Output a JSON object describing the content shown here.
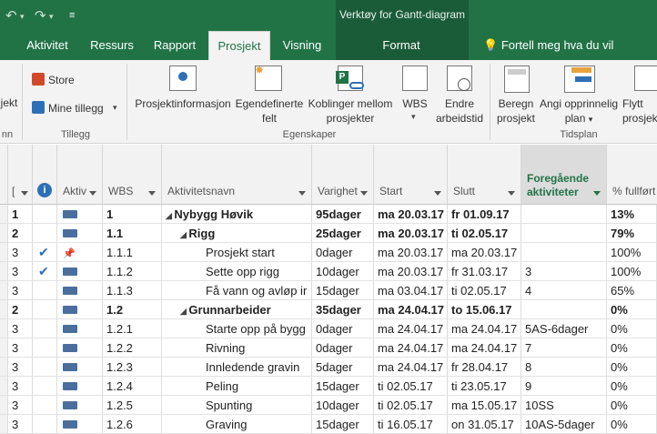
{
  "titlebar": {
    "undo_icon": "undo-icon",
    "redo_icon": "redo-icon",
    "contextual_tab": "Verktøy for Gantt-diagram"
  },
  "tabs": [
    {
      "label": "Aktivitet"
    },
    {
      "label": "Ressurs"
    },
    {
      "label": "Rapport"
    },
    {
      "label": "Prosjekt",
      "active": true
    },
    {
      "label": "Visning"
    },
    {
      "label": "Format"
    }
  ],
  "tellme": "Fortell meg hva du vil gjøre",
  "ribbon": {
    "partial_left": "jekt",
    "partial_left_group": "nn",
    "addins": {
      "store": "Store",
      "my_addins": "Mine tillegg",
      "group": "Tillegg"
    },
    "properties": {
      "project_info": "Prosjektinformasjon",
      "custom_fields": [
        "Egendefinerte",
        "felt"
      ],
      "links": [
        "Koblinger mellom",
        "prosjekter"
      ],
      "wbs": "WBS",
      "change_time": [
        "Endre",
        "arbeidstid"
      ],
      "group": "Egenskaper"
    },
    "schedule": {
      "calculate": [
        "Beregn",
        "prosjekt"
      ],
      "set_baseline": [
        "Angi opprinnelig",
        "plan"
      ],
      "move": [
        "Flytt",
        "prosjek"
      ],
      "group": "Tidsplan"
    }
  },
  "columns": {
    "indicator": "",
    "info": "",
    "mode": "Aktiv",
    "wbs": "WBS",
    "name": "Aktivitetsnavn",
    "duration": "Varighet",
    "start": "Start",
    "finish": "Slutt",
    "pred": [
      "Foregående",
      "aktiviteter"
    ],
    "pct": "% fullført"
  },
  "rows": [
    {
      "lvl": "1",
      "wbs": "1",
      "name": "Nybygg Høvik",
      "dur": "95dager",
      "start": "ma 20.03.17",
      "finish": "fr 01.09.17",
      "pred": "",
      "pct": "13%",
      "bold": true,
      "indent": 0,
      "collapse": true,
      "check": false,
      "pin": false
    },
    {
      "lvl": "2",
      "wbs": "1.1",
      "name": "Rigg",
      "dur": "25dager",
      "start": "ma 20.03.17",
      "finish": "ti 02.05.17",
      "pred": "",
      "pct": "79%",
      "bold": true,
      "indent": 1,
      "collapse": true,
      "check": false,
      "pin": false
    },
    {
      "lvl": "3",
      "wbs": "1.1.1",
      "name": "Prosjekt start",
      "dur": "0dager",
      "start": "ma 20.03.17",
      "finish": "ma 20.03.17",
      "pred": "",
      "pct": "100%",
      "bold": false,
      "indent": 2,
      "collapse": false,
      "check": true,
      "pin": true
    },
    {
      "lvl": "3",
      "wbs": "1.1.2",
      "name": "Sette opp rigg",
      "dur": "10dager",
      "start": "ma 20.03.17",
      "finish": "fr 31.03.17",
      "pred": "3",
      "pct": "100%",
      "bold": false,
      "indent": 2,
      "collapse": false,
      "check": true,
      "pin": false
    },
    {
      "lvl": "3",
      "wbs": "1.1.3",
      "name": "Få vann og avløp ir",
      "dur": "15dager",
      "start": "ma 03.04.17",
      "finish": "ti 02.05.17",
      "pred": "4",
      "pct": "65%",
      "bold": false,
      "indent": 2,
      "collapse": false,
      "check": false,
      "pin": false
    },
    {
      "lvl": "2",
      "wbs": "1.2",
      "name": "Grunnarbeider",
      "dur": "35dager",
      "start": "ma 24.04.17",
      "finish": "to 15.06.17",
      "pred": "",
      "pct": "0%",
      "bold": true,
      "indent": 1,
      "collapse": true,
      "check": false,
      "pin": false
    },
    {
      "lvl": "3",
      "wbs": "1.2.1",
      "name": "Starte opp på bygg",
      "dur": "0dager",
      "start": "ma 24.04.17",
      "finish": "ma 24.04.17",
      "pred": "5AS-6dager",
      "pct": "0%",
      "bold": false,
      "indent": 2,
      "collapse": false,
      "check": false,
      "pin": false
    },
    {
      "lvl": "3",
      "wbs": "1.2.2",
      "name": "Rivning",
      "dur": "0dager",
      "start": "ma 24.04.17",
      "finish": "ma 24.04.17",
      "pred": "7",
      "pct": "0%",
      "bold": false,
      "indent": 2,
      "collapse": false,
      "check": false,
      "pin": false
    },
    {
      "lvl": "3",
      "wbs": "1.2.3",
      "name": "Innledende gravin",
      "dur": "5dager",
      "start": "ma 24.04.17",
      "finish": "fr 28.04.17",
      "pred": "8",
      "pct": "0%",
      "bold": false,
      "indent": 2,
      "collapse": false,
      "check": false,
      "pin": false
    },
    {
      "lvl": "3",
      "wbs": "1.2.4",
      "name": "Peling",
      "dur": "15dager",
      "start": "ti 02.05.17",
      "finish": "ti 23.05.17",
      "pred": "9",
      "pct": "0%",
      "bold": false,
      "indent": 2,
      "collapse": false,
      "check": false,
      "pin": false
    },
    {
      "lvl": "3",
      "wbs": "1.2.5",
      "name": "Spunting",
      "dur": "10dager",
      "start": "ti 02.05.17",
      "finish": "ma 15.05.17",
      "pred": "10SS",
      "pct": "0%",
      "bold": false,
      "indent": 2,
      "collapse": false,
      "check": false,
      "pin": false
    },
    {
      "lvl": "3",
      "wbs": "1.2.6",
      "name": "Graving",
      "dur": "15dager",
      "start": "ti 16.05.17",
      "finish": "on 31.05.17",
      "pred": "10AS-5dager",
      "pct": "0%",
      "bold": false,
      "indent": 2,
      "collapse": false,
      "check": false,
      "pin": false
    }
  ],
  "colors": {
    "accent": "#217346",
    "ribbon": "#f3f3f3",
    "header": "#f2f2f2",
    "selected_header": "#dcdcdc",
    "check": "#2e6eb5",
    "task_icon": "#4a6f9e"
  }
}
